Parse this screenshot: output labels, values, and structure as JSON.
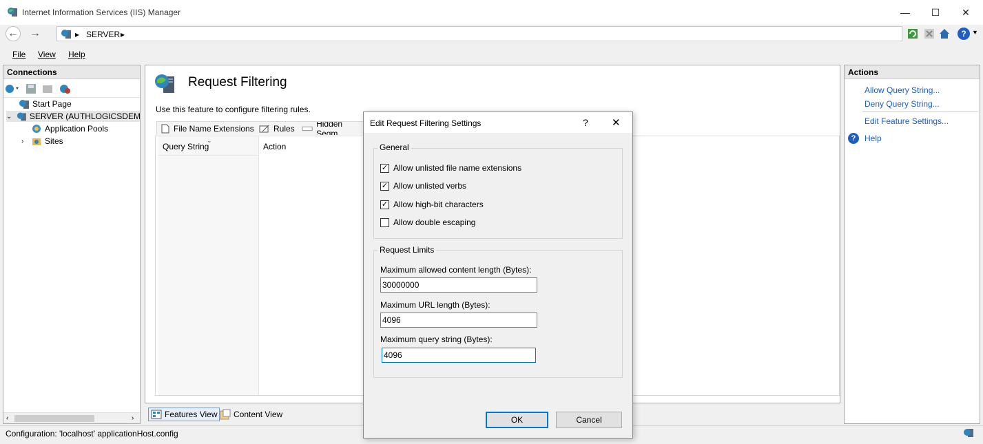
{
  "window": {
    "title": "Internet Information Services (IIS) Manager",
    "app_icon": "iis-manager-icon",
    "minimize": "—",
    "maximize": "☐",
    "close": "✕"
  },
  "addressbar": {
    "back": "←",
    "forward": "→",
    "path": [
      "SERVER"
    ],
    "separator": "▸",
    "help": "?"
  },
  "menu": {
    "file": "File",
    "view": "View",
    "help": "Help"
  },
  "connections": {
    "header": "Connections",
    "tree": {
      "start_page": "Start Page",
      "server": "SERVER (AUTHLOGICSDEMO\\",
      "app_pools": "Application Pools",
      "sites": "Sites"
    }
  },
  "content": {
    "title": "Request Filtering",
    "description": "Use this feature to configure filtering rules.",
    "tabs": [
      "File Name Extensions",
      "Rules",
      "Hidden Segm"
    ],
    "columns": [
      "Query String",
      "Action"
    ],
    "bottom_tabs": [
      "Features View",
      "Content View"
    ]
  },
  "actions": {
    "header": "Actions",
    "items": [
      "Allow Query String...",
      "Deny Query String...",
      "Edit Feature Settings...",
      "Help"
    ]
  },
  "statusbar": {
    "text": "Configuration: 'localhost' applicationHost.config"
  },
  "dialog": {
    "title": "Edit Request Filtering Settings",
    "help": "?",
    "close": "✕",
    "general": {
      "label": "General",
      "options": [
        {
          "label": "Allow unlisted file name extensions",
          "checked": true
        },
        {
          "label": "Allow unlisted verbs",
          "checked": true
        },
        {
          "label": "Allow high-bit characters",
          "checked": true
        },
        {
          "label": "Allow double escaping",
          "checked": false
        }
      ]
    },
    "limits": {
      "label": "Request Limits",
      "content_length_label": "Maximum allowed content length (Bytes):",
      "content_length_value": "30000000",
      "url_length_label": "Maximum URL length (Bytes):",
      "url_length_value": "4096",
      "query_string_label": "Maximum query string (Bytes):",
      "query_string_value": "4096"
    },
    "ok": "OK",
    "cancel": "Cancel"
  },
  "colors": {
    "link": "#1f5fbf",
    "focus": "#0078d7"
  }
}
